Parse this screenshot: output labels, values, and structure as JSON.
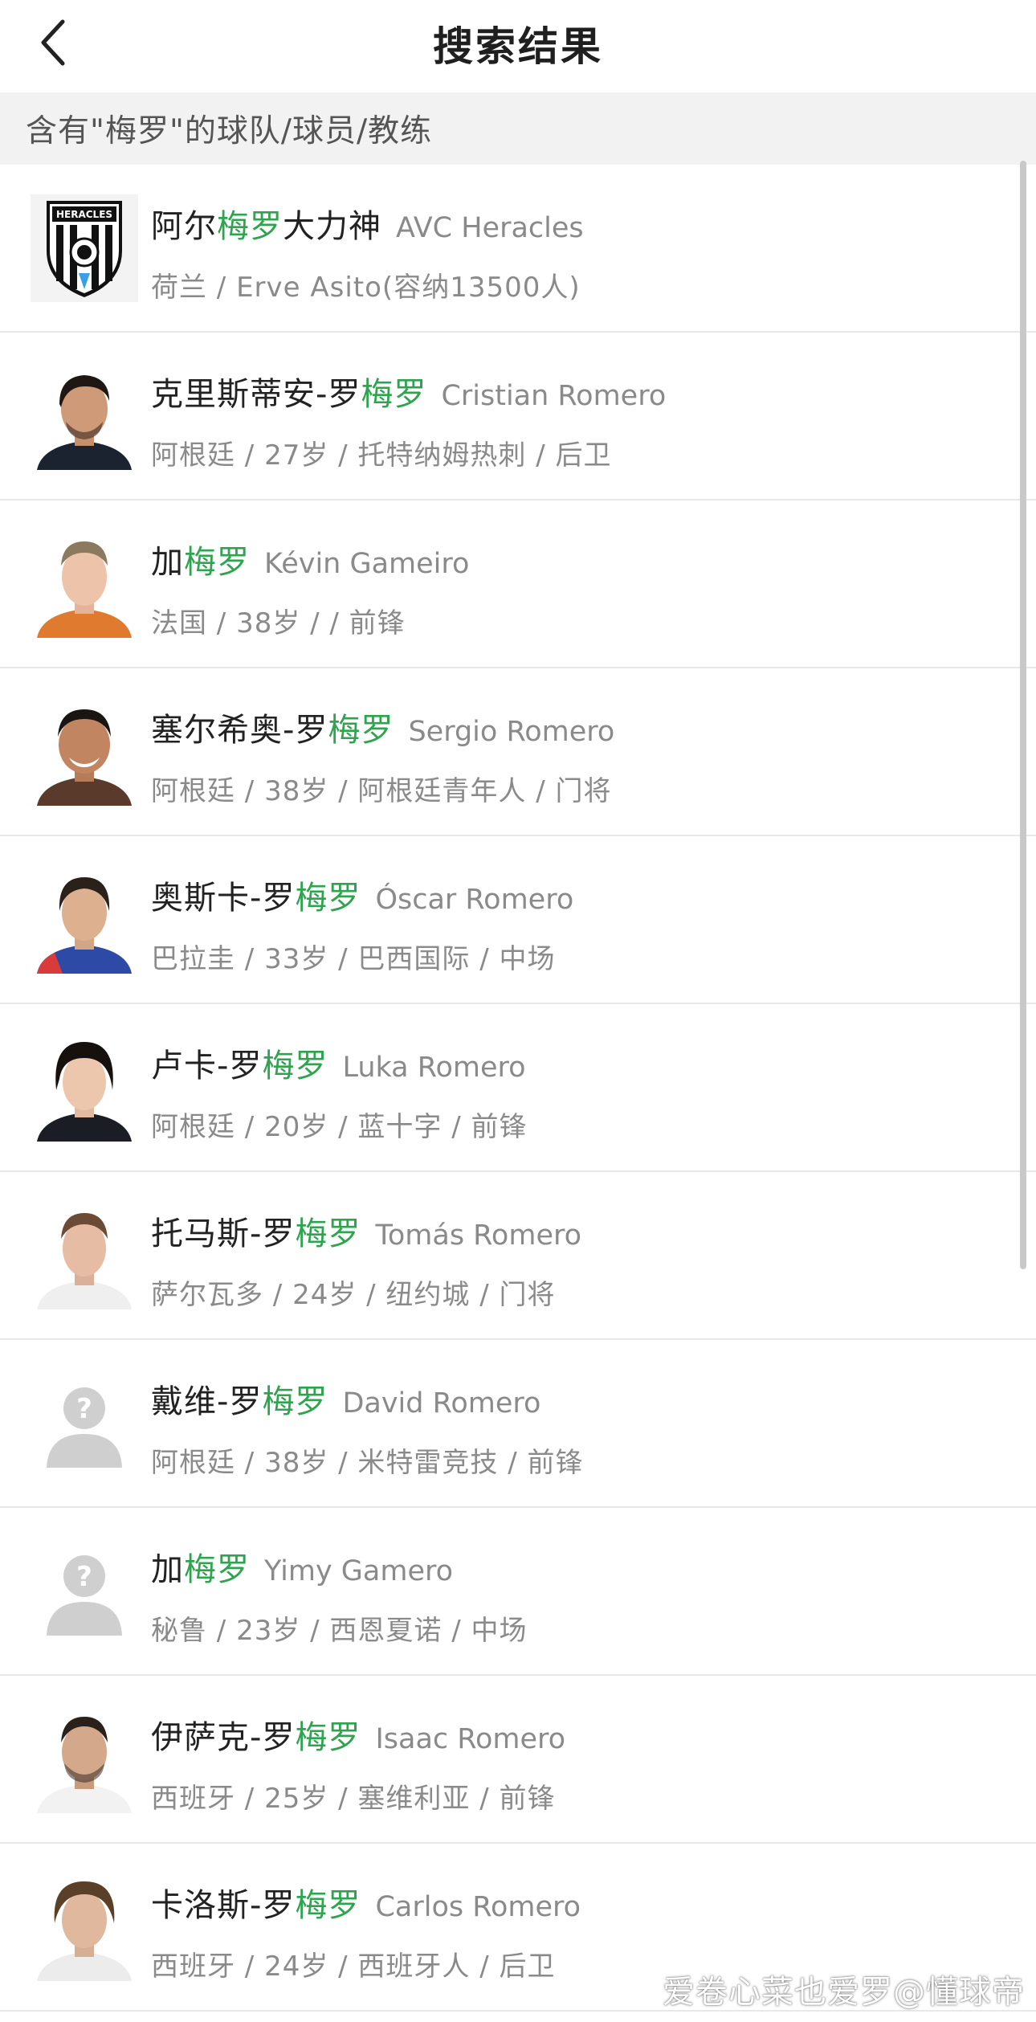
{
  "header": {
    "title": "搜索结果"
  },
  "section": {
    "label": "含有\"梅罗\"的球队/球员/教练"
  },
  "results": [
    {
      "kind": "team",
      "name_pre": "阿尔",
      "name_hl": "梅罗",
      "name_post": "大力神",
      "name_en": "AVC Heracles",
      "meta": "荷兰 / Erve Asito(容纳13500人)"
    },
    {
      "kind": "player",
      "name_pre": "克里斯蒂安-罗",
      "name_hl": "梅罗",
      "name_post": "",
      "name_en": "Cristian Romero",
      "meta": "阿根廷 / 27岁 / 托特纳姆热刺 / 后卫"
    },
    {
      "kind": "player",
      "name_pre": "加",
      "name_hl": "梅罗",
      "name_post": "",
      "name_en": "Kévin Gameiro",
      "meta": "法国 / 38岁 /  / 前锋"
    },
    {
      "kind": "player",
      "name_pre": "塞尔希奥-罗",
      "name_hl": "梅罗",
      "name_post": "",
      "name_en": "Sergio Romero",
      "meta": "阿根廷 / 38岁 / 阿根廷青年人 / 门将"
    },
    {
      "kind": "player",
      "name_pre": "奥斯卡-罗",
      "name_hl": "梅罗",
      "name_post": "",
      "name_en": "Óscar Romero",
      "meta": "巴拉圭 / 33岁 / 巴西国际 / 中场"
    },
    {
      "kind": "player",
      "name_pre": "卢卡-罗",
      "name_hl": "梅罗",
      "name_post": "",
      "name_en": "Luka Romero",
      "meta": "阿根廷 / 20岁 / 蓝十字 / 前锋"
    },
    {
      "kind": "player",
      "name_pre": "托马斯-罗",
      "name_hl": "梅罗",
      "name_post": "",
      "name_en": "Tomás Romero",
      "meta": "萨尔瓦多 / 24岁 / 纽约城 / 门将"
    },
    {
      "kind": "unknown",
      "name_pre": "戴维-罗",
      "name_hl": "梅罗",
      "name_post": "",
      "name_en": "David Romero",
      "meta": "阿根廷 / 38岁 / 米特雷竞技 / 前锋"
    },
    {
      "kind": "unknown",
      "name_pre": "加",
      "name_hl": "梅罗",
      "name_post": "",
      "name_en": "Yimy Gamero",
      "meta": "秘鲁 / 23岁 / 西恩夏诺 / 中场"
    },
    {
      "kind": "player",
      "name_pre": "伊萨克-罗",
      "name_hl": "梅罗",
      "name_post": "",
      "name_en": "Isaac Romero",
      "meta": "西班牙 / 25岁 / 塞维利亚 / 前锋"
    },
    {
      "kind": "player",
      "name_pre": "卡洛斯-罗",
      "name_hl": "梅罗",
      "name_post": "",
      "name_en": "Carlos Romero",
      "meta": "西班牙 / 24岁 / 西班牙人 / 后卫"
    }
  ],
  "watermark": "爱卷心菜也爱罗@懂球帝",
  "colors": {
    "highlight": "#2ea44f",
    "section_bg": "#f2f2f2",
    "secondary_text": "#8a8a8a"
  },
  "icons": {
    "back": "chevron-left-icon",
    "unknown_avatar": "user-placeholder-icon",
    "team_logo": "heracles-logo"
  }
}
